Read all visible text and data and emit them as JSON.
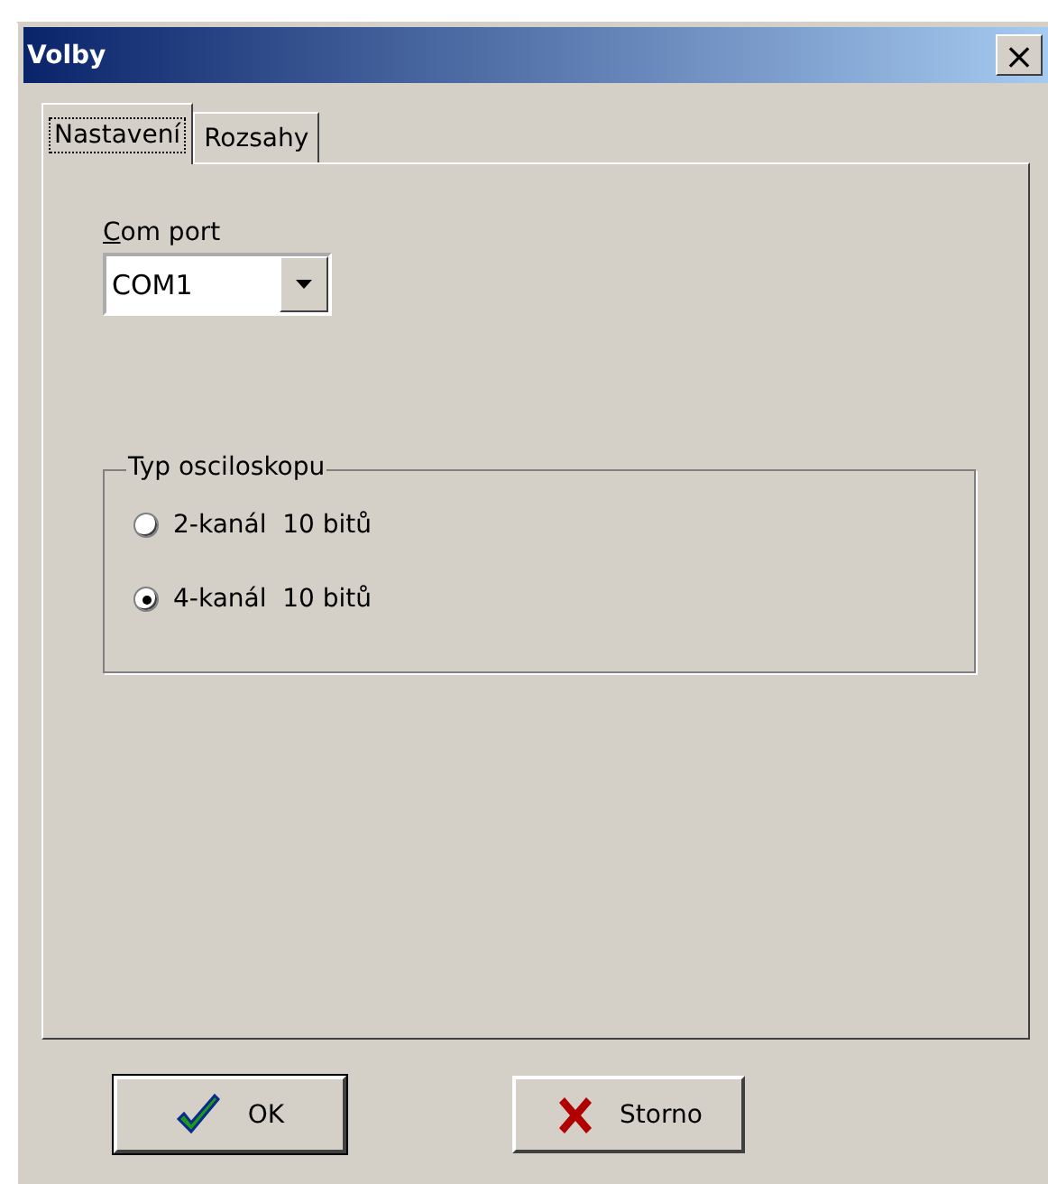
{
  "window": {
    "title": "Volby",
    "close": "×"
  },
  "tabs": [
    {
      "label": "Nastavení",
      "selected": true
    },
    {
      "label": "Rozsahy",
      "selected": false
    }
  ],
  "com_port": {
    "label": "Com port",
    "value": "COM1"
  },
  "oscilloscope_type": {
    "title": "Typ osciloskopu",
    "options": [
      {
        "label": "2-kanál  10 bitů",
        "selected": false
      },
      {
        "label": "4-kanál  10 bitů",
        "selected": true
      }
    ]
  },
  "buttons": [
    {
      "kind": "ok",
      "label": "OK",
      "default": true
    },
    {
      "kind": "cancel",
      "label": "Storno",
      "default": false
    }
  ]
}
